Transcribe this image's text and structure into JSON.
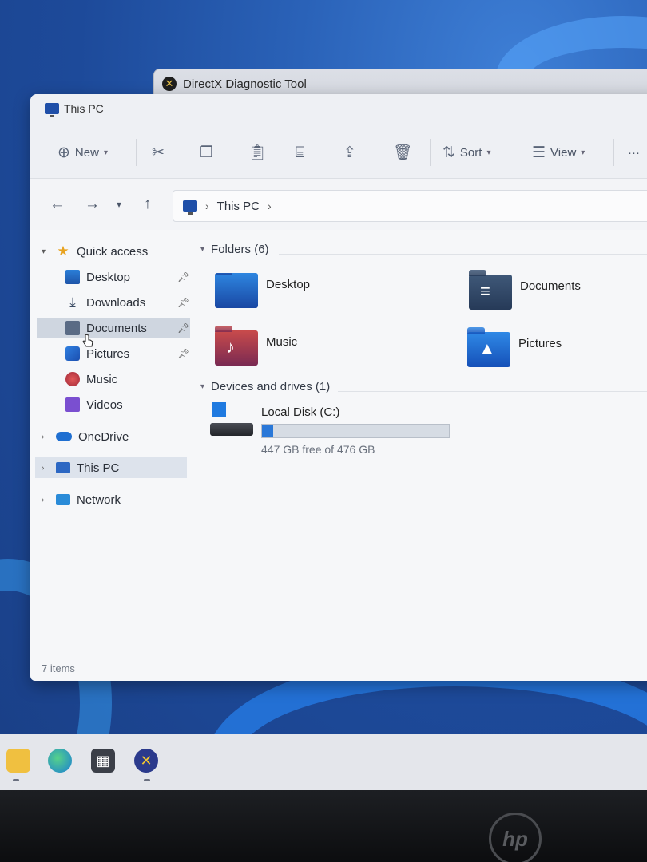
{
  "background_window": {
    "title": "DirectX Diagnostic Tool"
  },
  "window": {
    "title": "This PC"
  },
  "toolbar": {
    "new_label": "New",
    "sort_label": "Sort",
    "view_label": "View",
    "more_label": "···"
  },
  "address": {
    "path_label": "This PC"
  },
  "sidebar": {
    "quick_access": "Quick access",
    "items": [
      {
        "label": "Desktop",
        "icon": "desktop-icon",
        "pinned": true
      },
      {
        "label": "Downloads",
        "icon": "download-icon",
        "pinned": true
      },
      {
        "label": "Documents",
        "icon": "documents-icon",
        "pinned": true
      },
      {
        "label": "Pictures",
        "icon": "pictures-icon",
        "pinned": true
      },
      {
        "label": "Music",
        "icon": "music-icon",
        "pinned": false
      },
      {
        "label": "Videos",
        "icon": "videos-icon",
        "pinned": false
      }
    ],
    "onedrive": "OneDrive",
    "this_pc": "This PC",
    "network": "Network"
  },
  "main": {
    "folders_header": "Folders (6)",
    "folders": [
      {
        "label": "Desktop"
      },
      {
        "label": "Documents"
      },
      {
        "label": "Music"
      },
      {
        "label": "Pictures"
      }
    ],
    "devices_header": "Devices and drives (1)",
    "drive": {
      "name": "Local Disk (C:)",
      "free_text": "447 GB free of 476 GB",
      "used_fraction": 0.061
    }
  },
  "status": {
    "items": "7 items"
  },
  "colors": {
    "accent": "#2a78d8",
    "selection": "#dde3ec"
  }
}
